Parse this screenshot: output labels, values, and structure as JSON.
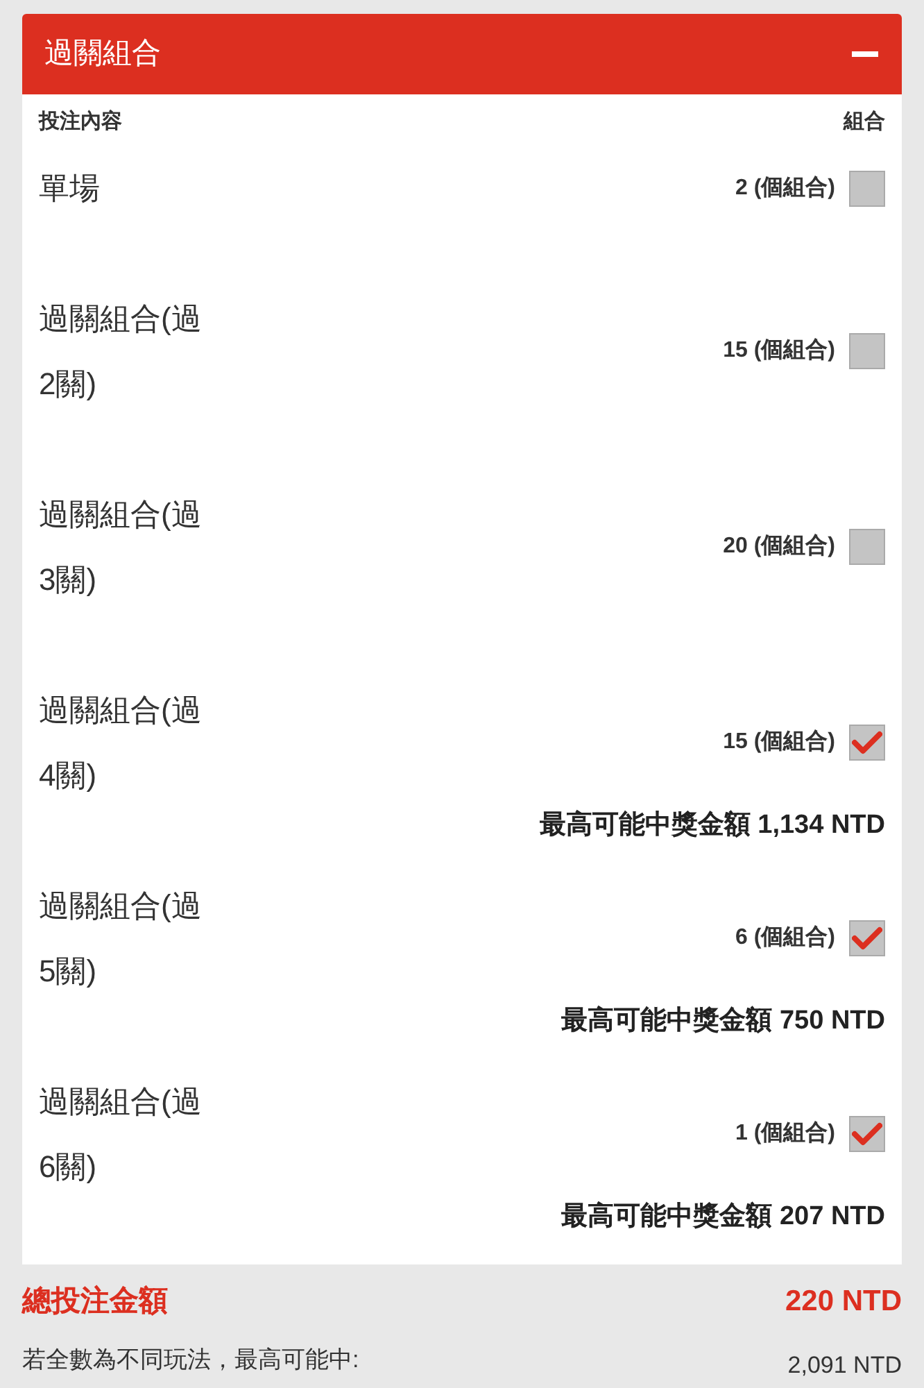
{
  "panel": {
    "title": "過關組合",
    "expanded": true
  },
  "columns": [
    "投注內容",
    "組合"
  ],
  "rows": [
    {
      "name": "單場",
      "count": "2 (個組合)",
      "checked": false
    },
    {
      "name": "過關組合(過2關)",
      "count": "15 (個組合)",
      "checked": false
    },
    {
      "name": "過關組合(過3關)",
      "count": "20 (個組合)",
      "checked": false
    },
    {
      "name": "過關組合(過4關)",
      "count": "15 (個組合)",
      "checked": true,
      "prize": "最高可能中獎金額 1,134 NTD"
    },
    {
      "name": "過關組合(過5關)",
      "count": "6 (個組合)",
      "checked": true,
      "prize": "最高可能中獎金額 750 NTD"
    },
    {
      "name": "過關組合(過6關)",
      "count": "1 (個組合)",
      "checked": true,
      "prize": "最高可能中獎金額 207 NTD"
    }
  ],
  "total": {
    "label": "總投注金額",
    "value": "220 NTD"
  },
  "max_win": {
    "label": "若全數為不同玩法，最高可能中:",
    "value": "2,091 NTD"
  }
}
